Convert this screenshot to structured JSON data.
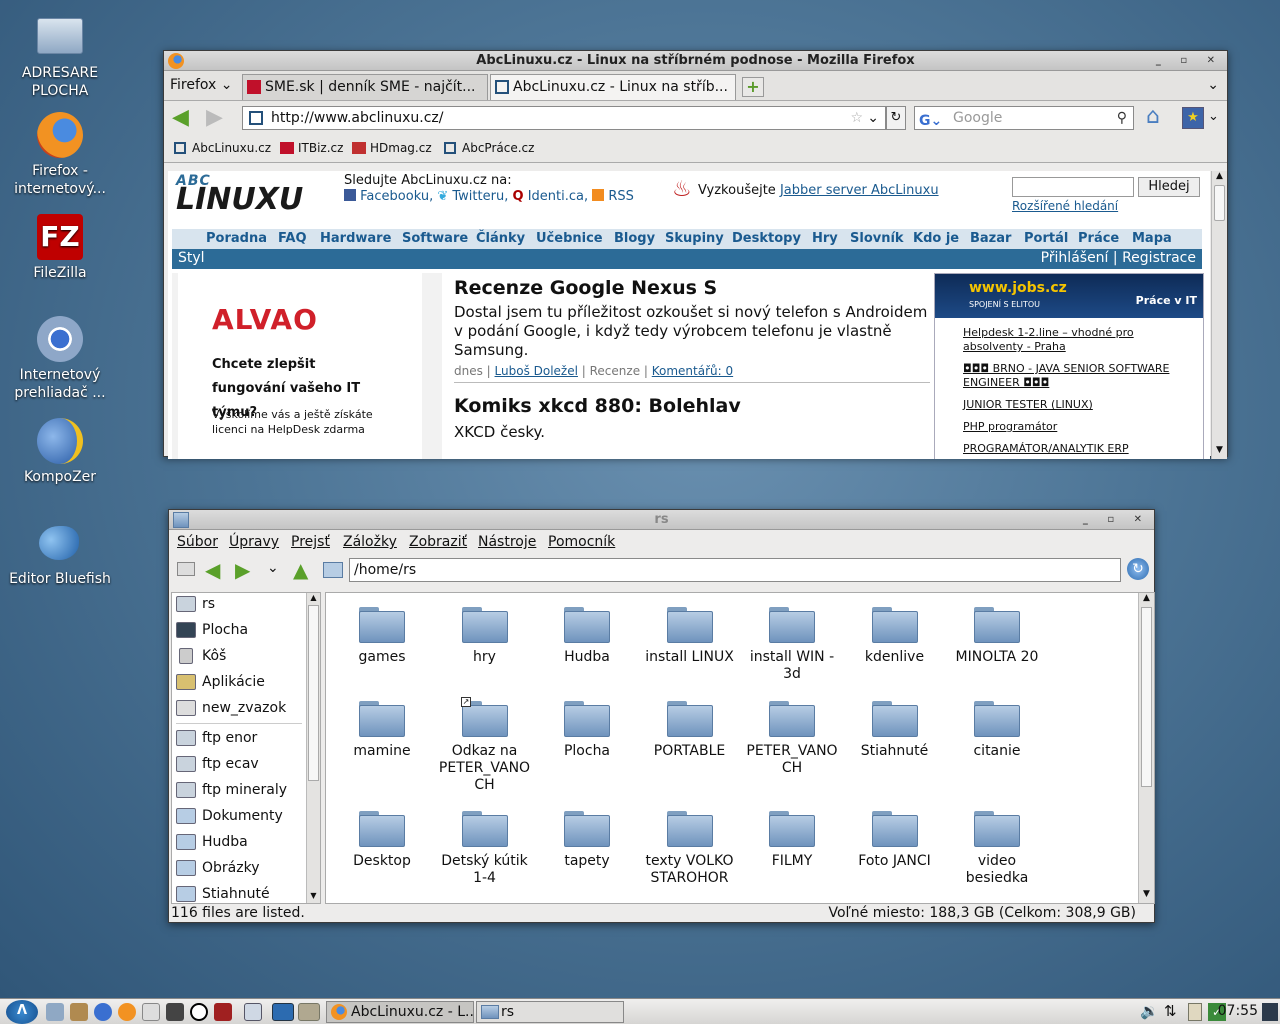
{
  "desktop": {
    "icons": [
      {
        "label": "ADRESARE PLOCHA",
        "name": "adresare-plocha-icon"
      },
      {
        "label": "Firefox - internetový...",
        "name": "firefox-icon"
      },
      {
        "label": "FileZilla",
        "name": "filezilla-icon"
      },
      {
        "label": "Internetový prehliadač ...",
        "name": "chromium-icon"
      },
      {
        "label": "KompoZer",
        "name": "kompozer-icon"
      },
      {
        "label": "Editor Bluefish",
        "name": "bluefish-icon"
      }
    ]
  },
  "firefox": {
    "title": "AbcLinuxu.cz - Linux na stříbrném podnose - Mozilla Firefox",
    "firefox_menu": "Firefox",
    "tabs": [
      "SME.sk | denník SME - najčít...",
      "AbcLinuxu.cz - Linux na stříb..."
    ],
    "url": "http://www.abclinuxu.cz/",
    "search_placeholder": "Google",
    "bookmarks": [
      "AbcLinuxu.cz",
      "ITBiz.cz",
      "HDmag.cz",
      "AbcPráce.cz"
    ],
    "page": {
      "logo_top": "ABC",
      "logo_bottom": "LINUXU",
      "follow_label": "Sledujte AbcLinuxu.cz na:",
      "follow_links": [
        "Facebooku,",
        "Twitteru,",
        "Identi.ca,",
        "RSS"
      ],
      "jabber_prefix": "Vyzkoušejte ",
      "jabber_link": "Jabber server AbcLinuxu",
      "search_button": "Hledej",
      "advanced_search": "Rozšířené hledání",
      "nav": [
        "Poradna",
        "FAQ",
        "Hardware",
        "Software",
        "Články",
        "Učebnice",
        "Blogy",
        "Skupiny",
        "Desktopy",
        "Hry",
        "Slovník",
        "Kdo je",
        "Bazar",
        "Portál",
        "Práce",
        "Mapa"
      ],
      "styl": "Styl",
      "login": "Přihlášení",
      "register": "Registrace",
      "ad_brand": "ALVAO",
      "ad_headline": "Chcete zlepšit fungování vašeho IT týmu?",
      "ad_body": "Vyškolíme vás a ještě získáte licenci na HelpDesk zdarma",
      "article1_title": "Recenze Google Nexus S",
      "article1_text": "Dostal jsem tu příležitost ozkoušet si nový telefon s Androidem v podání Google, i když tedy výrobcem telefonu je vlastně Samsung.",
      "article1_meta_date": "dnes",
      "article1_author": "Luboš Doležel",
      "article1_section": "Recenze",
      "article1_comments": "Komentářů: 0",
      "article2_title": "Komiks xkcd 880: Bolehlav",
      "article2_text": "XKCD česky.",
      "jobs_logo": "www.jobs.cz",
      "jobs_tag": "SPOJENÍ S ELITOU",
      "jobs_header": "Práce v IT",
      "jobs": [
        "Helpdesk 1-2.line – vhodné pro absolventy - Praha",
        "◘◘◘ BRNO - JAVA SENIOR SOFTWARE ENGINEER ◘◘◘",
        "JUNIOR TESTER (LINUX)",
        "PHP programátor",
        "PROGRAMÁTOR/ANALYTIK ERP"
      ]
    }
  },
  "filemanager": {
    "title": "rs",
    "menu": [
      "Súbor",
      "Úpravy",
      "Prejsť",
      "Záložky",
      "Zobraziť",
      "Nástroje",
      "Pomocník"
    ],
    "path": "/home/rs",
    "sidebar": [
      "rs",
      "Plocha",
      "Kôš",
      "Aplikácie",
      "new_zvazok",
      "ftp enor",
      "ftp ecav",
      "ftp mineraly",
      "Dokumenty",
      "Hudba",
      "Obrázky",
      "Stiahnuté"
    ],
    "folders": [
      [
        "games",
        "hry",
        "Hudba",
        "install LINUX",
        "install WIN - 3d",
        "kdenlive",
        "MINOLTA 20"
      ],
      [
        "mamine",
        "Odkaz na PETER_VANO CH",
        "Plocha",
        "PORTABLE",
        "PETER_VANO CH",
        "Stiahnuté",
        "citanie"
      ],
      [
        "Desktop",
        "Detský kútik 1-4",
        "tapety",
        "texty VOLKO STAROHOR",
        "FILMY",
        "Foto JANCI",
        "video besiedka"
      ]
    ],
    "status_left": "116 files are listed.",
    "status_right": "Voľné miesto: 188,3 GB (Celkom: 308,9 GB)"
  },
  "taskbar": {
    "tasks": [
      "AbcLinuxu.cz - L...",
      "rs"
    ],
    "clock": "07:55"
  },
  "colors": {
    "accent": "#2c6b97",
    "link": "#1a5a8f",
    "desktop": "#4d7596"
  }
}
